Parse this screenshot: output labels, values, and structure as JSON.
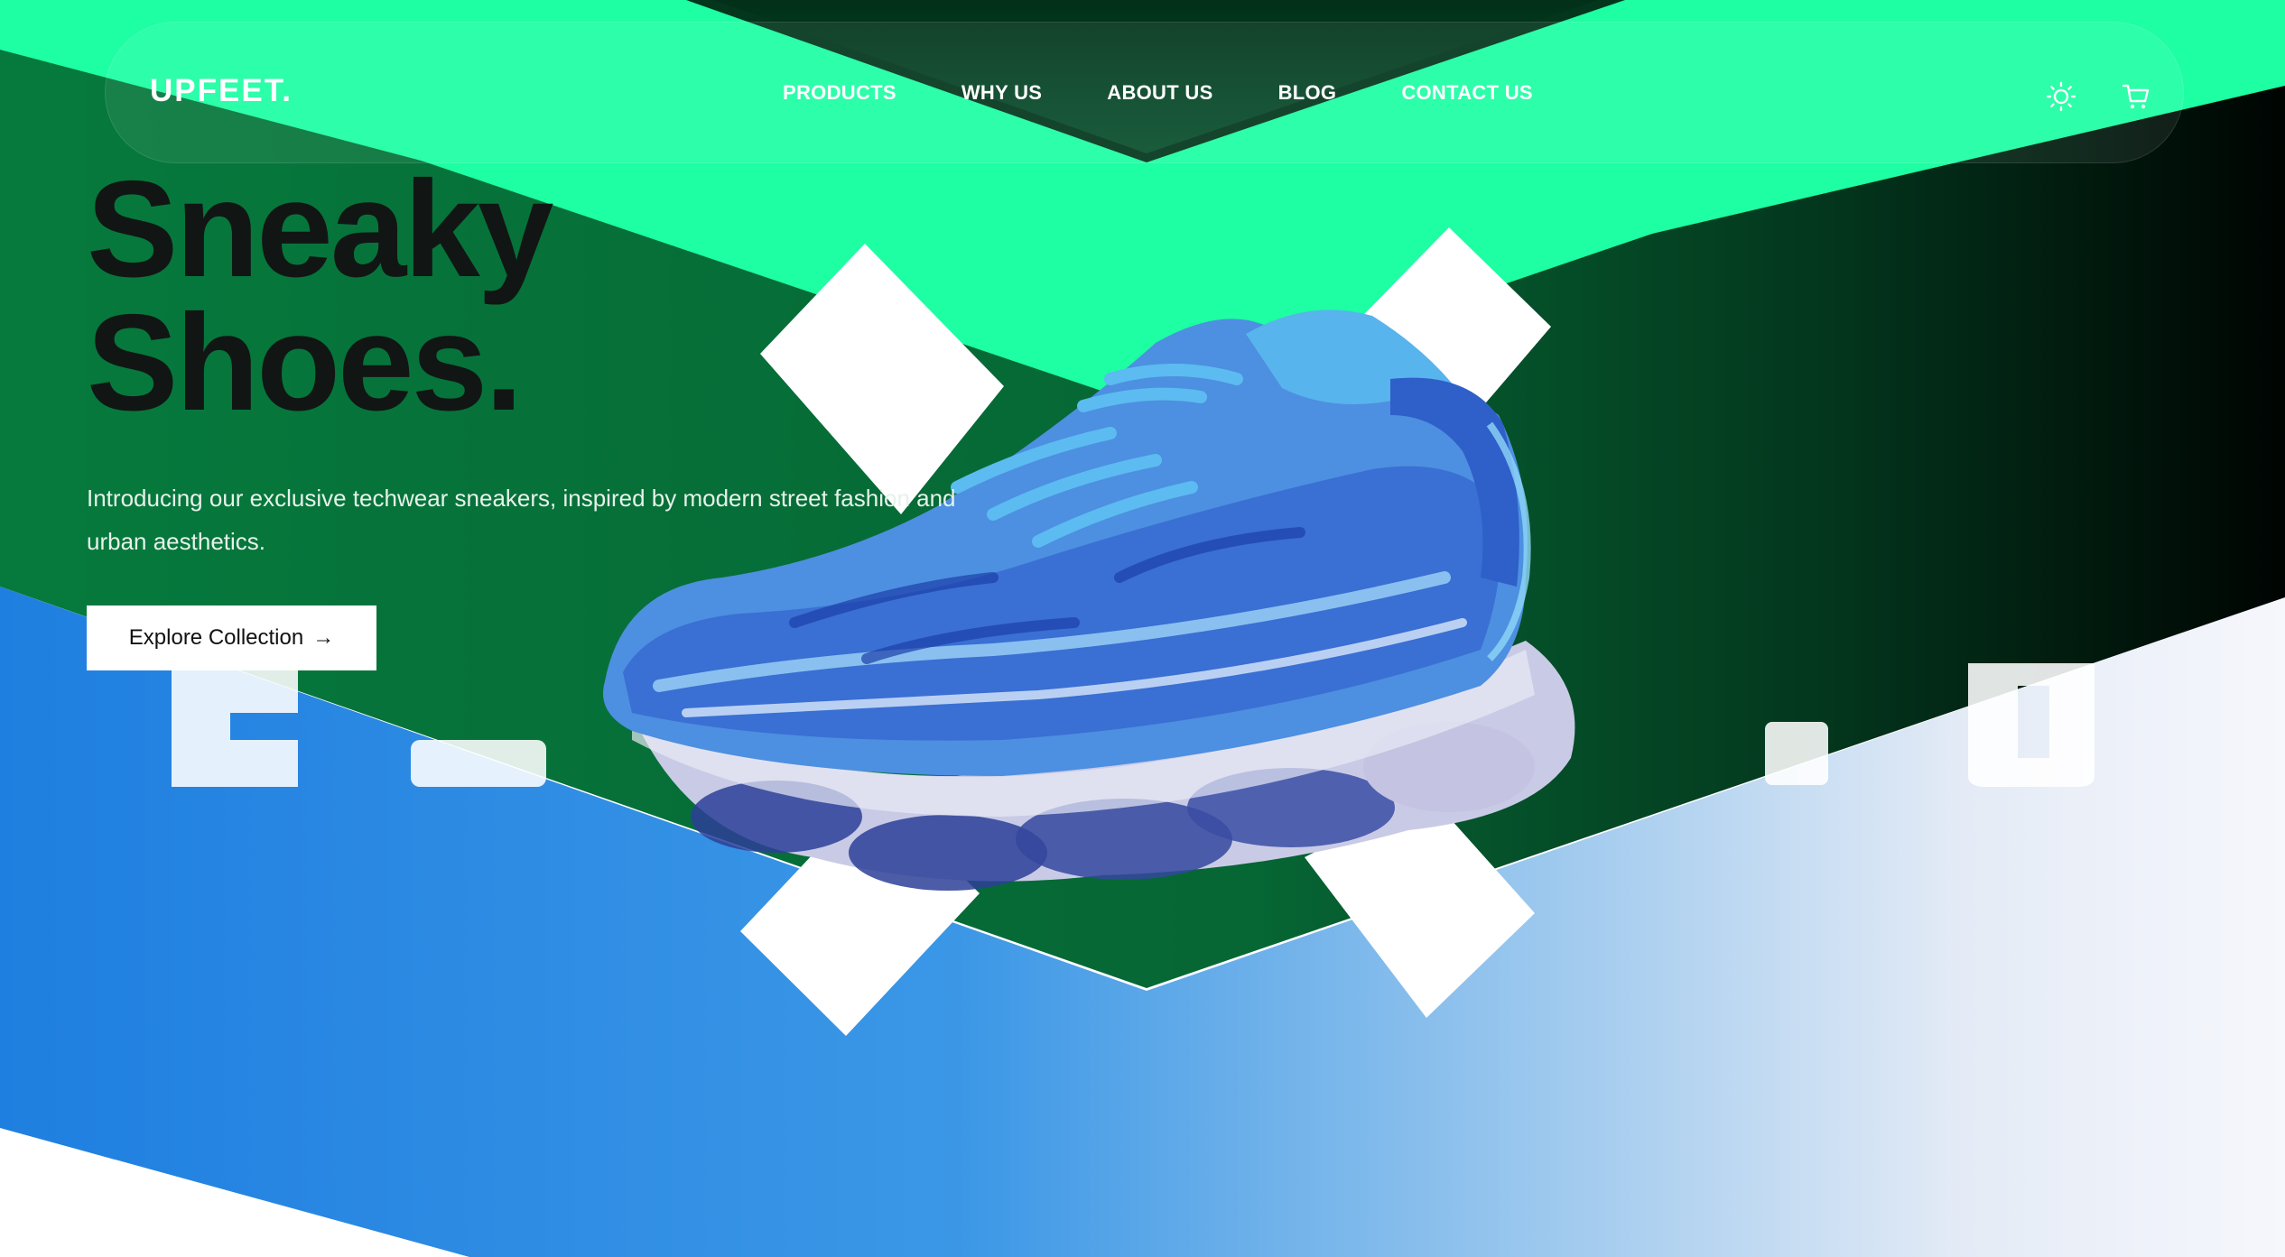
{
  "brand": {
    "logo": "UPFEET."
  },
  "nav": {
    "links": [
      "PRODUCTS",
      "WHY US",
      "ABOUT US",
      "BLOG",
      "CONTACT US"
    ]
  },
  "header_icons": [
    "sun-icon",
    "cart-icon"
  ],
  "hero": {
    "title_line1": "Sneaky",
    "title_line2": "Shoes.",
    "description": "Introducing our exclusive techwear sneakers, inspired by modern street fashion and urban aesthetics.",
    "cta_label": "Explore Collection",
    "cta_arrow": "→"
  },
  "colors": {
    "accent_green": "#1efea3",
    "dark_green": "#066634",
    "sky_blue": "#2c8de4",
    "ink": "#111614"
  }
}
